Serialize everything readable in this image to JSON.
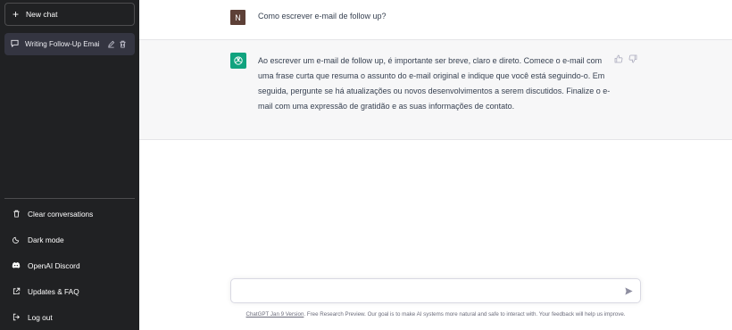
{
  "sidebar": {
    "new_chat": "New chat",
    "chats": [
      {
        "title": "Writing Follow-Up Emai"
      }
    ],
    "menu": [
      {
        "label": "Clear conversations",
        "icon": "trash-icon"
      },
      {
        "label": "Dark mode",
        "icon": "moon-icon"
      },
      {
        "label": "OpenAI Discord",
        "icon": "discord-icon"
      },
      {
        "label": "Updates & FAQ",
        "icon": "external-link-icon"
      },
      {
        "label": "Log out",
        "icon": "logout-icon"
      }
    ]
  },
  "conversation": {
    "user": {
      "avatar_letter": "N",
      "message": "Como escrever e-mail de follow up?"
    },
    "assistant": {
      "message": "Ao escrever um e-mail de follow up, é importante ser breve, claro e direto. Comece o e-mail com uma frase curta que resuma o assunto do e-mail original e indique que você está seguindo-o. Em seguida, pergunte se há atualizações ou novos desenvolvimentos a serem discutidos. Finalize o e-mail com uma expressão de gratidão e as suas informações de contato."
    }
  },
  "composer": {
    "value": "",
    "placeholder": ""
  },
  "footer": {
    "version_link": "ChatGPT Jan 9 Version",
    "text": ". Free Research Preview. Our goal is to make AI systems more natural and safe to interact with. Your feedback will help us improve."
  },
  "colors": {
    "sidebar_bg": "#202123",
    "accent": "#10a37f",
    "user_avatar": "#5d4037",
    "assistant_bg": "#f7f7f8"
  }
}
